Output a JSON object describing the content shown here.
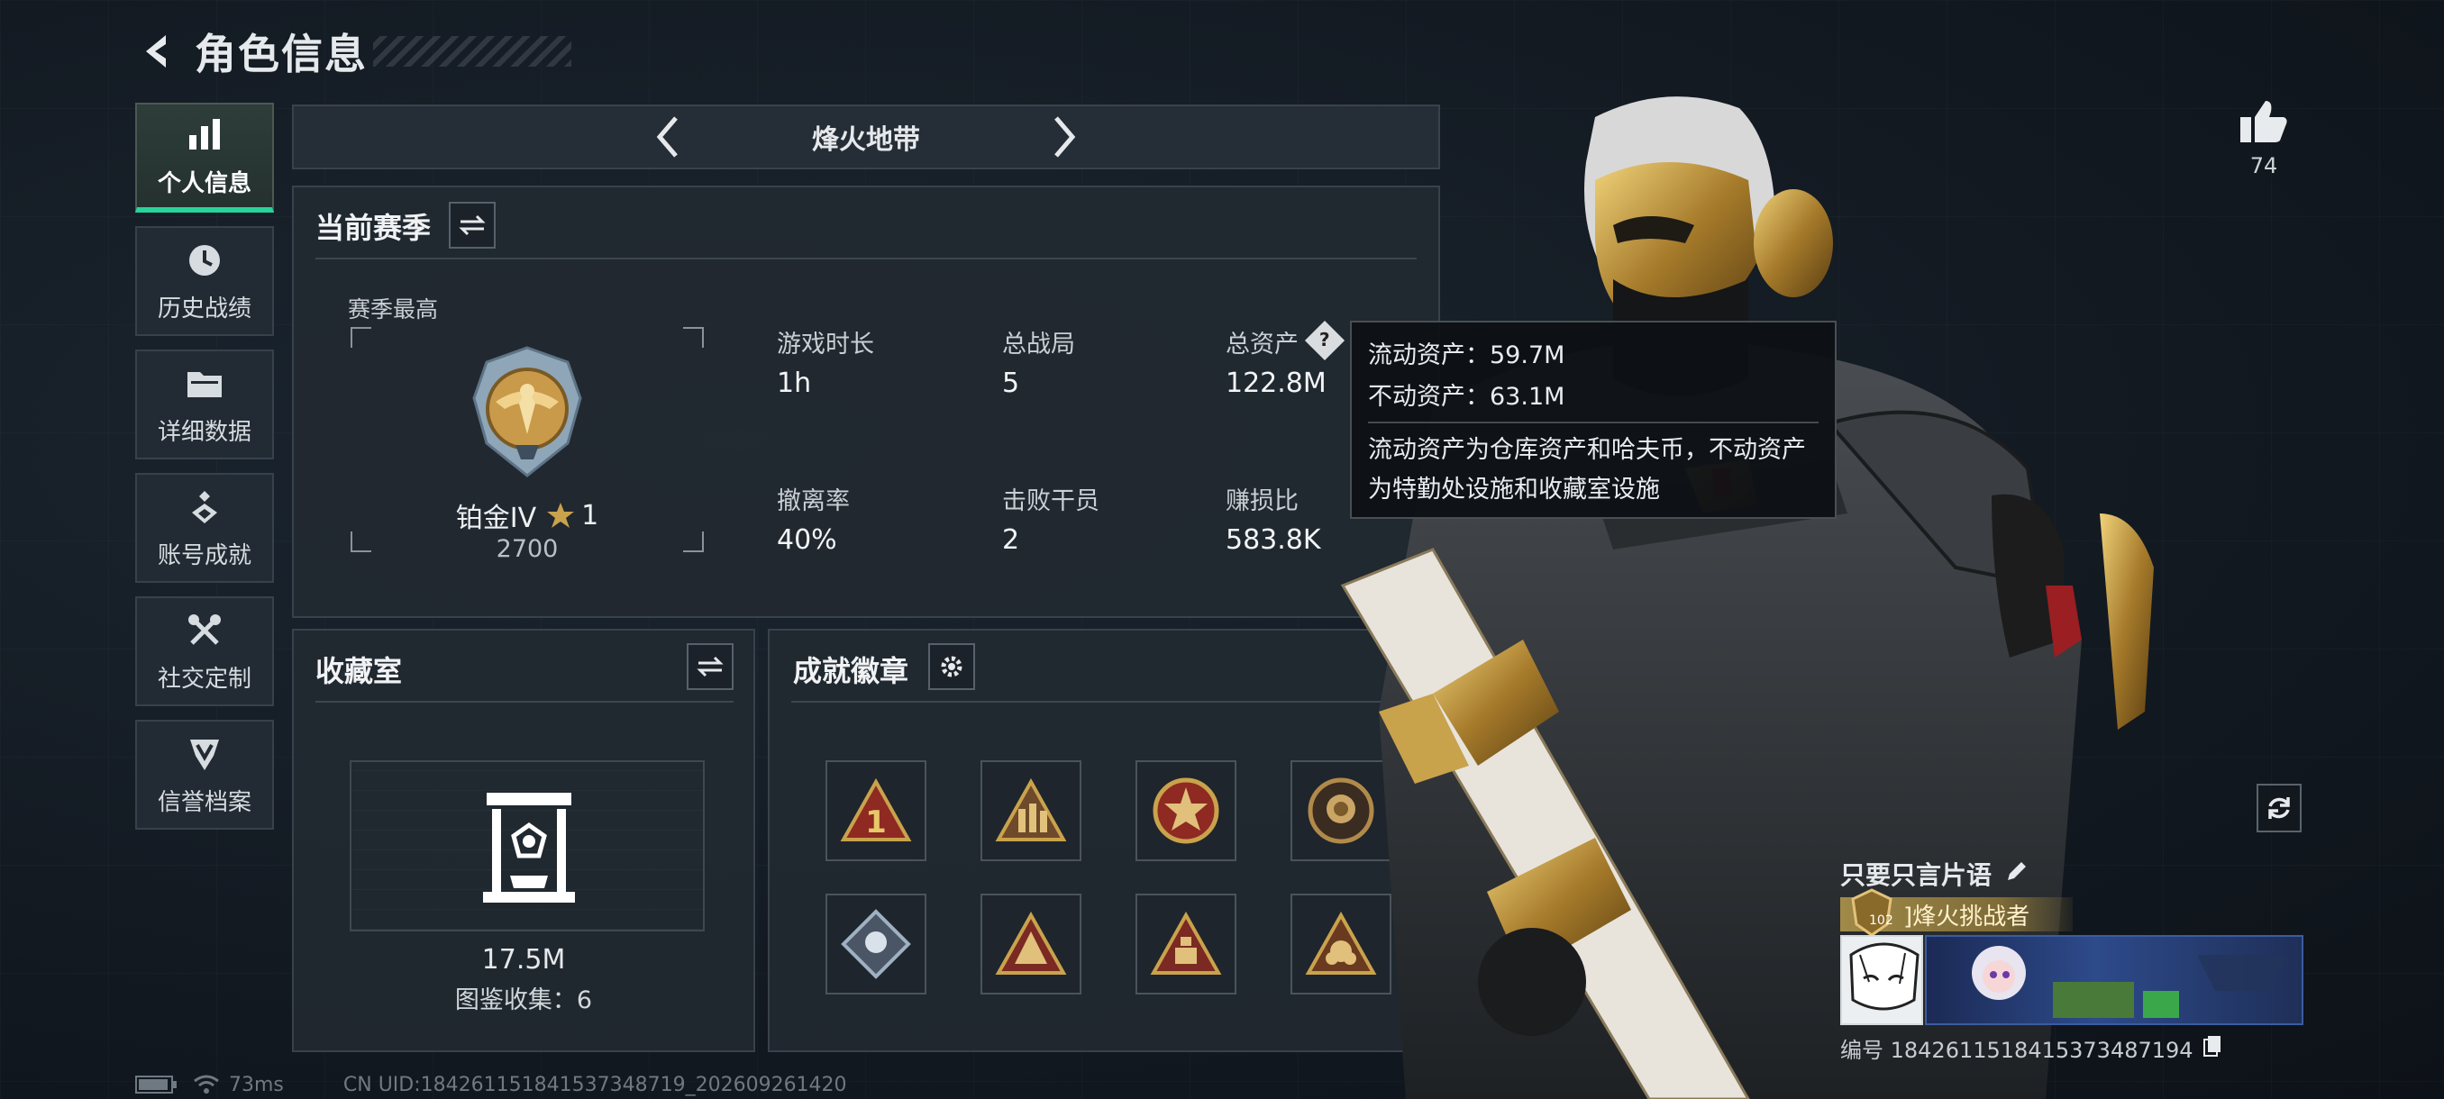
{
  "header": {
    "title": "角色信息"
  },
  "nav": [
    {
      "label": "个人信息",
      "icon": "bar-chart-icon",
      "active": true
    },
    {
      "label": "历史战绩",
      "icon": "clock-icon"
    },
    {
      "label": "详细数据",
      "icon": "folder-icon"
    },
    {
      "label": "账号成就",
      "icon": "achievement-icon"
    },
    {
      "label": "社交定制",
      "icon": "tools-icon"
    },
    {
      "label": "信誉档案",
      "icon": "shield-icon"
    }
  ],
  "mode": {
    "title": "烽火地带"
  },
  "season": {
    "title": "当前赛季",
    "best_label": "赛季最高",
    "rank_name": "铂金IV",
    "rank_stars": "1",
    "rank_points": "2700",
    "stats": [
      {
        "label": "游戏时长",
        "value": "1h"
      },
      {
        "label": "总战局",
        "value": "5"
      },
      {
        "label": "总资产",
        "value": "122.8M"
      },
      {
        "label": "撤离率",
        "value": "40%"
      },
      {
        "label": "击败干员",
        "value": "2"
      },
      {
        "label": "赚损比",
        "value": "583.8K"
      }
    ]
  },
  "tooltip": {
    "liquid": "流动资产：59.7M",
    "fixed": "不动资产：63.1M",
    "desc_line1": "流动资产为仓库资产和哈夫币，不动资产",
    "desc_line2": "为特勤处设施和收藏室设施"
  },
  "collection": {
    "title": "收藏室",
    "value": "17.5M",
    "count_label": "图鉴收集：6"
  },
  "badges": {
    "title": "成就徽章",
    "items": [
      "rank-one-badge",
      "squad-badge",
      "star-emblem-badge",
      "rose-badge",
      "crystal-badge",
      "tent-badge",
      "stack-badge",
      "flower-badge"
    ]
  },
  "social": {
    "like_count": "74"
  },
  "profile": {
    "motto": "只要只言片语",
    "level": "102",
    "title_text": "]烽火挑战者",
    "id_text": "编号 1842611518415373487194"
  },
  "status": {
    "ping": "73ms",
    "uid": "CN UID:184261151841537348719_202609261420"
  },
  "colors": {
    "accent": "#27d49a",
    "gold": "#c9a24c",
    "panel": "#222931"
  }
}
